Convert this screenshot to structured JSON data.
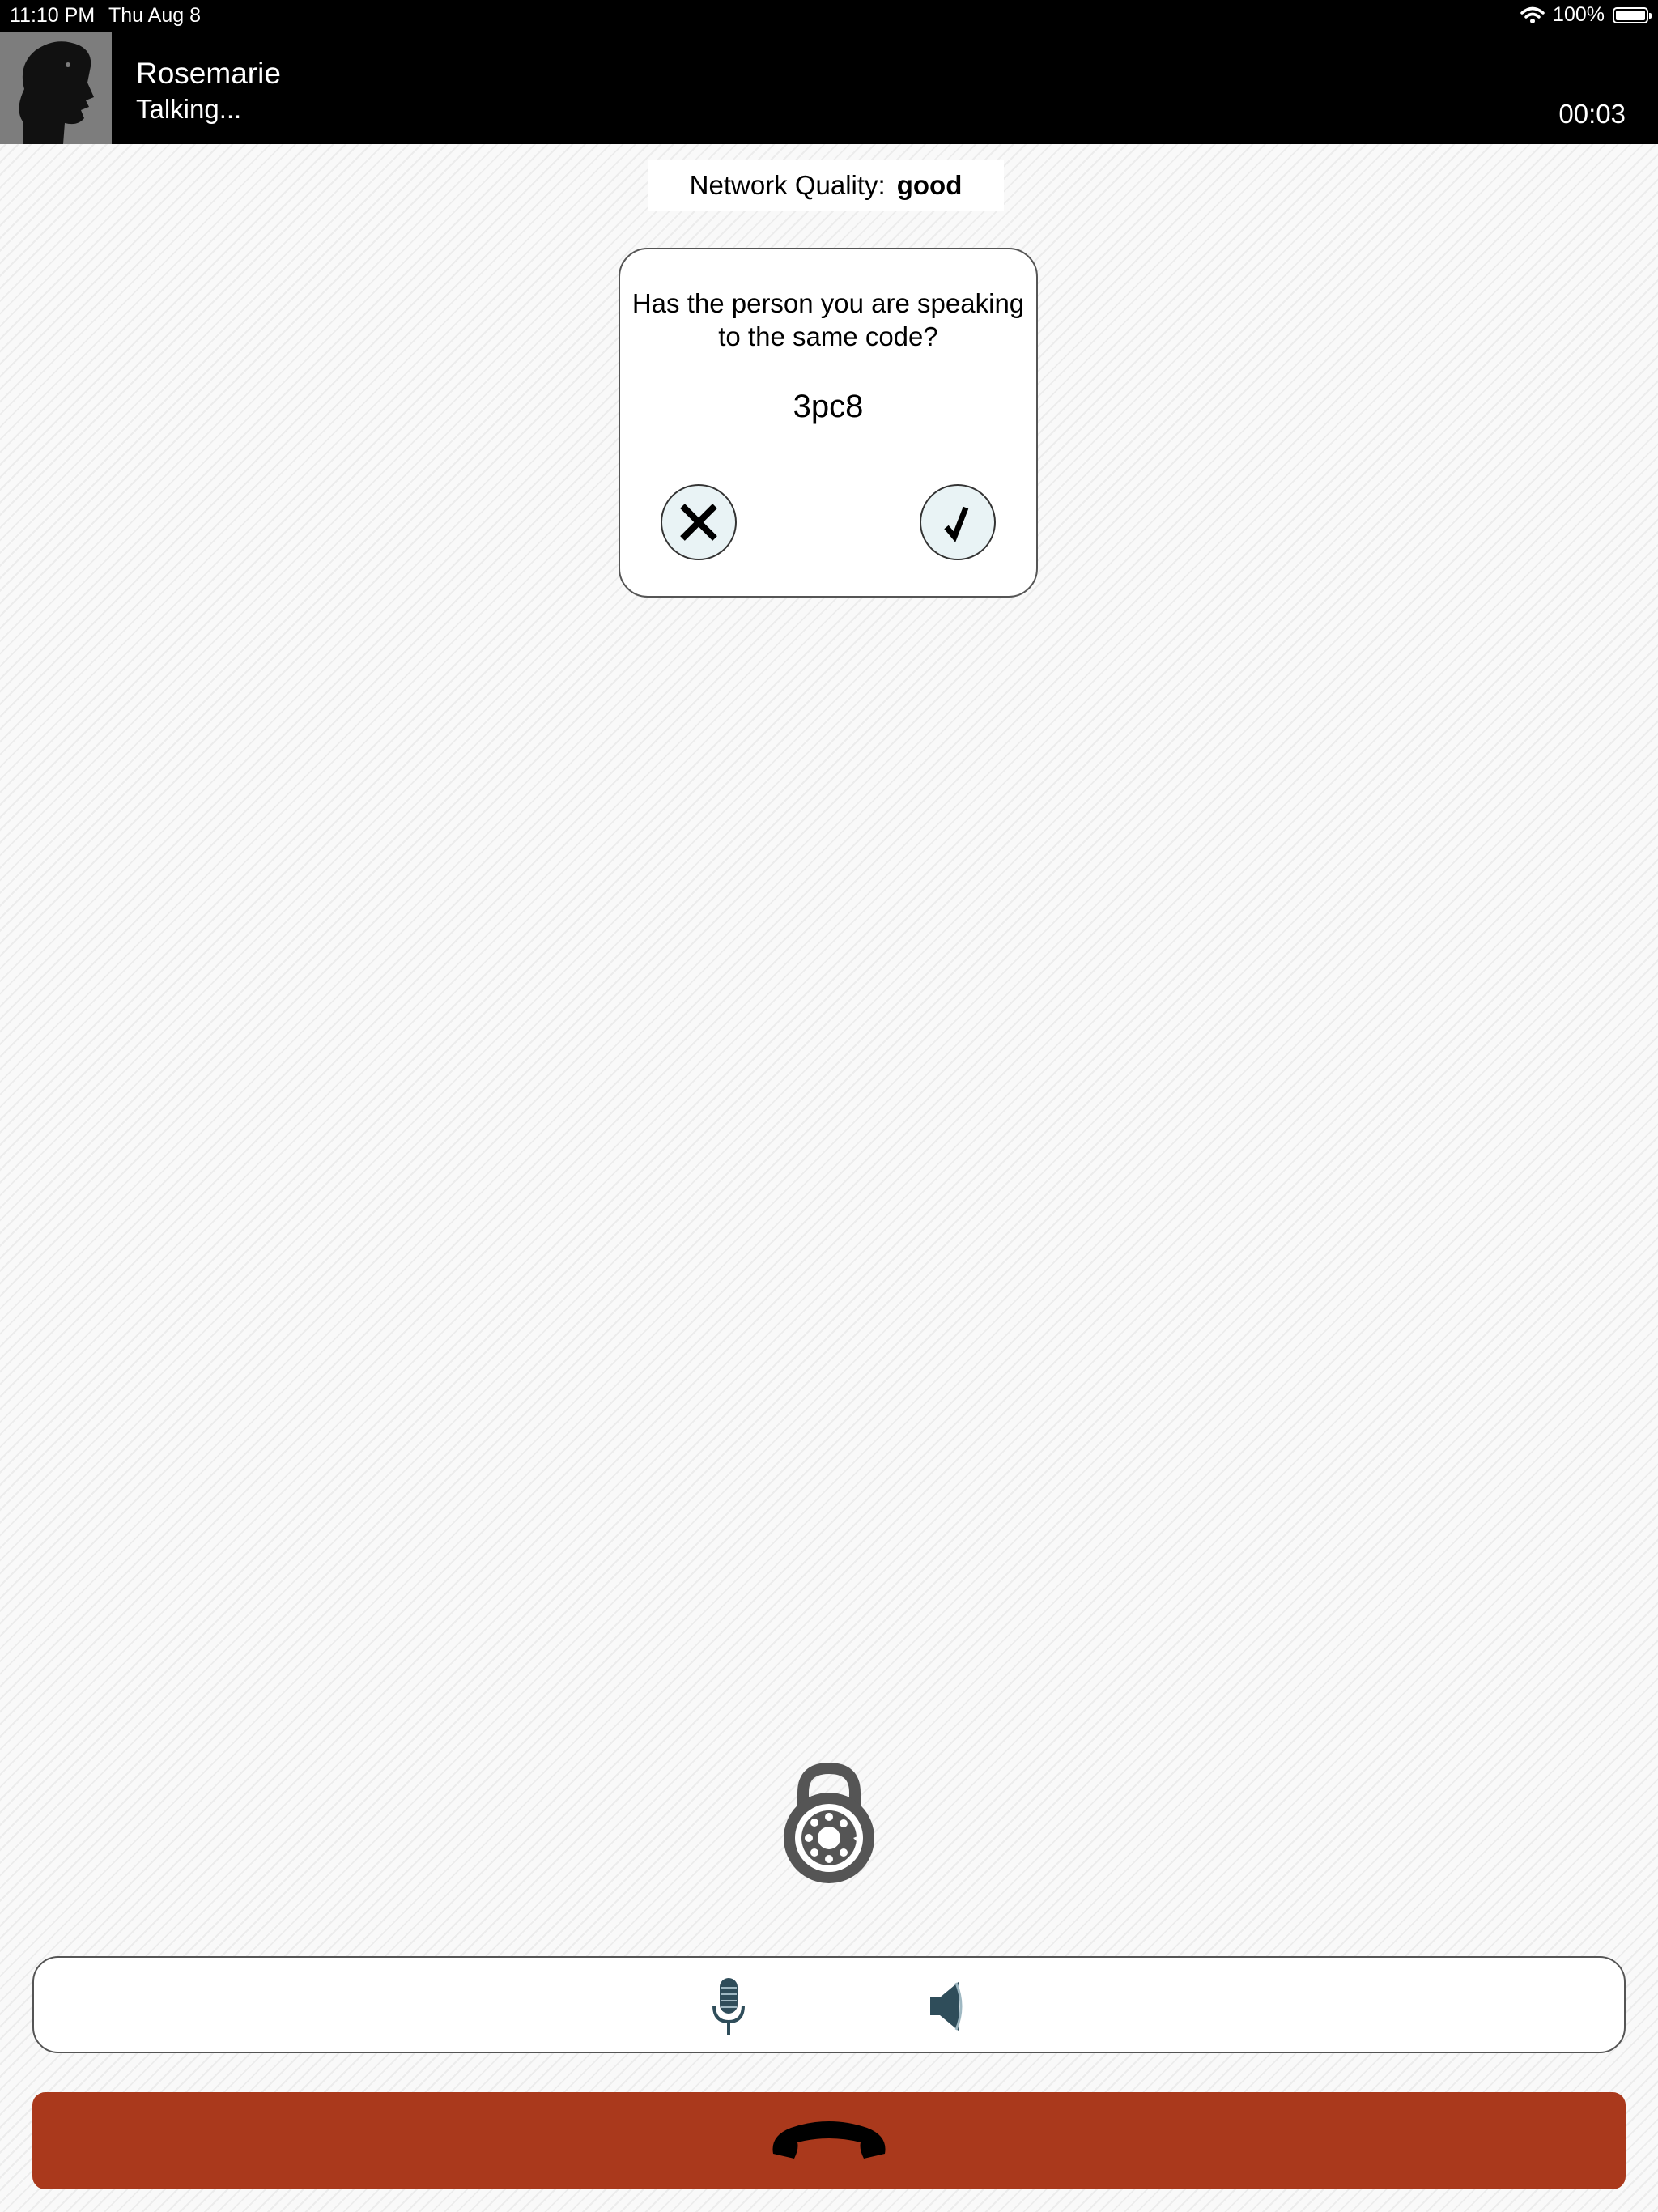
{
  "status_bar": {
    "time": "11:10 PM",
    "date": "Thu Aug 8",
    "battery_text": "100%",
    "battery_level": 1.0,
    "wifi_icon": "wifi-icon"
  },
  "call": {
    "name": "Rosemarie",
    "status": "Talking...",
    "timer": "00:03",
    "avatar_icon": "silhouette-avatar"
  },
  "network": {
    "label": "Network Quality:",
    "value": "good"
  },
  "verification": {
    "question": "Has the person you are speaking to the same code?",
    "code": "3pc8",
    "reject_icon": "x-icon",
    "confirm_icon": "checkmark-icon"
  },
  "controls": {
    "lock_icon": "dial-lock-icon",
    "mic_icon": "microphone-icon",
    "speaker_icon": "speaker-icon",
    "hangup_icon": "hang-up-phone-icon"
  },
  "colors": {
    "header_bg": "#000000",
    "hangup_bg": "#aa391c",
    "button_bg": "#e9f3f5",
    "icon_accent": "#2f4d5a"
  }
}
